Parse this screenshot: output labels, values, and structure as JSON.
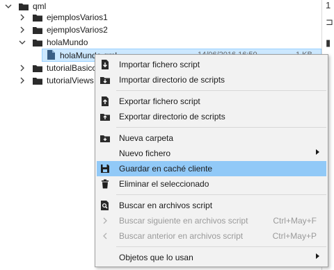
{
  "tree": {
    "root": "qml",
    "folders": [
      "ejemplosVarios1",
      "ejemplosVarios2",
      "holaMundo",
      "tutorialBasico",
      "tutorialViews"
    ],
    "selected_file": {
      "name": "holaMundo.qml",
      "date": "14/06/2016 16:50",
      "size": "1 KB"
    }
  },
  "side_panel": {
    "glyphs": [
      "1",
      "⊐",
      "▮"
    ]
  },
  "context_menu": {
    "items": [
      {
        "label": "Importar fichero script",
        "icon": "import-file-icon",
        "enabled": true
      },
      {
        "label": "Importar directorio de scripts",
        "icon": "import-folder-icon",
        "enabled": true
      },
      {
        "label": "Exportar fichero script",
        "icon": "export-file-icon",
        "enabled": true
      },
      {
        "label": "Exportar directorio de scripts",
        "icon": "export-folder-icon",
        "enabled": true
      },
      {
        "label": "Nueva carpeta",
        "icon": "new-folder-icon",
        "enabled": true
      },
      {
        "label": "Nuevo fichero",
        "icon": "",
        "enabled": true,
        "submenu": true
      },
      {
        "label": "Guardar en caché cliente",
        "icon": "save-icon",
        "enabled": true,
        "highlighted": true
      },
      {
        "label": "Eliminar el seleccionado",
        "icon": "trash-icon",
        "enabled": true
      },
      {
        "label": "Buscar en archivos script",
        "icon": "search-icon",
        "enabled": true
      },
      {
        "label": "Buscar siguiente en archivos script",
        "icon": "chevron-right-icon",
        "enabled": false,
        "shortcut": "Ctrl+May+F"
      },
      {
        "label": "Buscar anterior en archivos script",
        "icon": "chevron-left-icon",
        "enabled": false,
        "shortcut": "Ctrl+May+P"
      },
      {
        "label": "Objetos que lo usan",
        "icon": "",
        "enabled": true,
        "submenu": true
      }
    ]
  },
  "colors": {
    "selection_bg": "#cce8ff",
    "menu_highlight": "#91c9f7",
    "menu_bg": "#f2f2f2"
  }
}
